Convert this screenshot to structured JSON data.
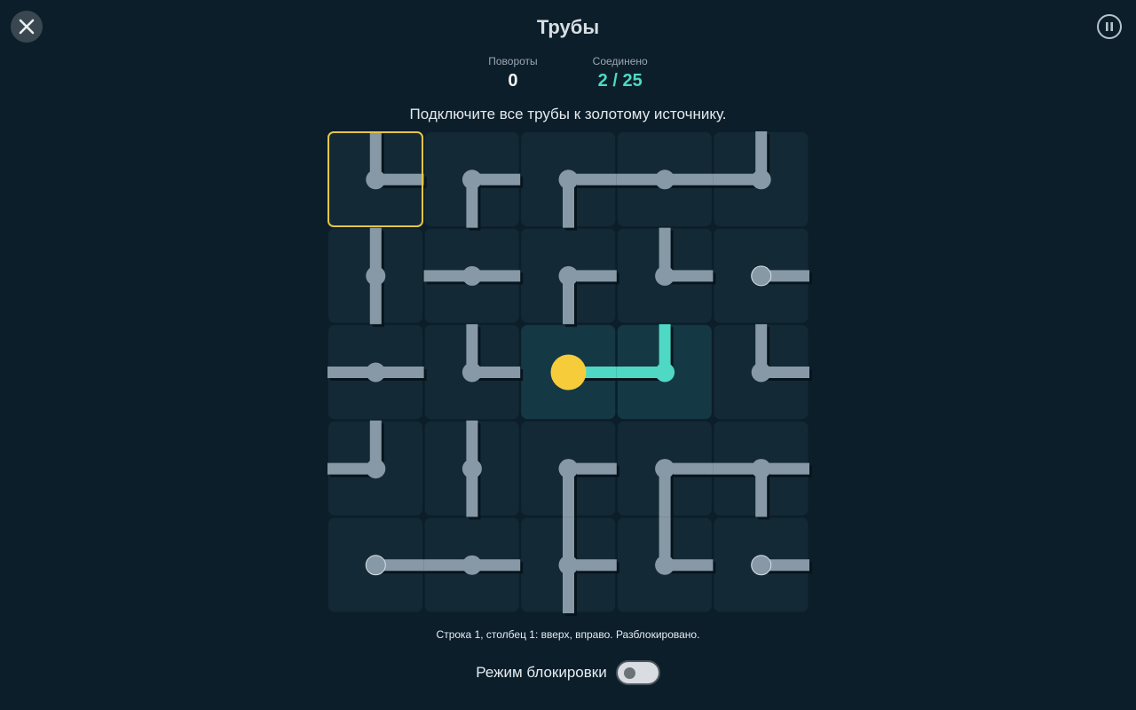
{
  "header": {
    "title": "Трубы",
    "close_icon": "close-icon",
    "pause_icon": "pause-icon"
  },
  "stats": {
    "turns_label": "Повороты",
    "turns_value": "0",
    "connected_label": "Соединено",
    "connected_value": "2 / 25"
  },
  "instruction": "Подключите все трубы к золотому источнику.",
  "board": {
    "rows": 5,
    "cols": 5,
    "source": [
      2,
      2
    ],
    "selected": [
      0,
      0
    ],
    "cells": [
      [
        "UR",
        "RD",
        "RD",
        "LR",
        "UL"
      ],
      [
        "UD",
        "LR",
        "RD",
        "UR",
        "R"
      ],
      [
        "LR",
        "UR",
        "R",
        "UL",
        "UR"
      ],
      [
        "UL",
        "UD",
        "RD",
        "RD",
        "LRD"
      ],
      [
        "R",
        "LR",
        "URD",
        "UR",
        "R"
      ]
    ],
    "connected": [
      [
        2,
        2
      ],
      [
        2,
        3
      ]
    ],
    "colors": {
      "tile": "#132a36",
      "tile_connected": "#153845",
      "pipe": "#8799a7",
      "pipe_connected": "#4fd8c4",
      "source": "#f7cc3b",
      "selection": "#e5c54a"
    }
  },
  "status_line": "Строка 1, столбец 1: вверх, вправо. Разблокировано.",
  "lock_mode": {
    "label": "Режим блокировки",
    "enabled": false
  }
}
